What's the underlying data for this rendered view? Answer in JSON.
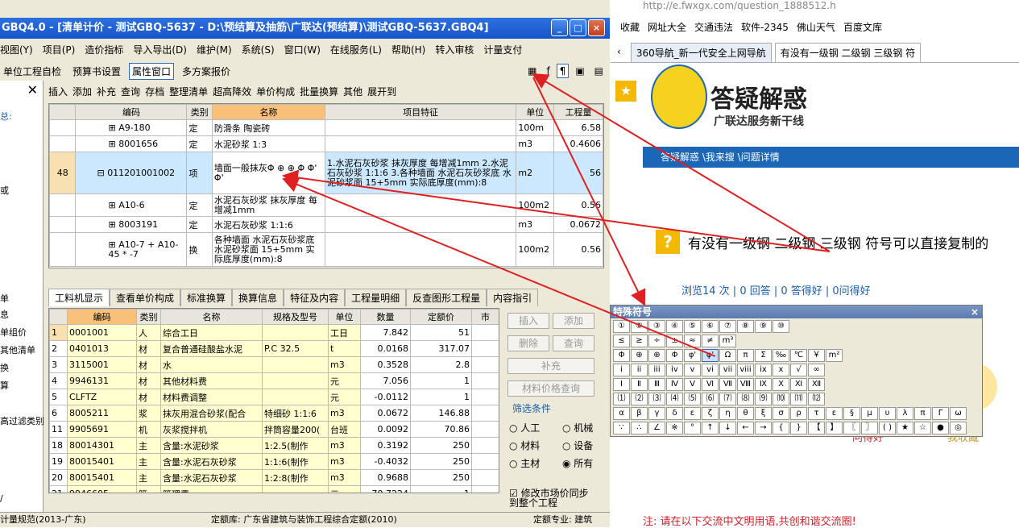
{
  "app": {
    "title": "GBQ4.0 - [清单计价 - 测试GBQ-5637 - D:\\预结算及抽筋\\广联达(预结算)\\测试GBQ-5637.GBQ4]",
    "window_buttons": [
      "_",
      "□",
      "×"
    ],
    "menu": [
      "视图(Y)",
      "项目(P)",
      "造价指标",
      "导入导出(D)",
      "维护(M)",
      "系统(S)",
      "窗口(W)",
      "在线服务(L)",
      "帮助(H)",
      "转入审核",
      "计量支付"
    ],
    "toolbar1": [
      "单位工程自检",
      "预算书设置",
      "属性窗口",
      "多方案报价"
    ],
    "toolbar2": [
      "插入",
      "添加",
      "补充",
      "查询",
      "存档",
      "整理清单",
      "超高降效",
      "单价构成",
      "批量换算",
      "其他",
      "展开到"
    ],
    "left_items": [
      "总:",
      "或",
      "单",
      "息",
      "单组价",
      "其他清单",
      "换",
      "算",
      "高过滤类别",
      "/"
    ],
    "top_headers": [
      "编码",
      "类别",
      "名称",
      "项目特征",
      "单位",
      "工程量"
    ],
    "top_rows": [
      {
        "no": "",
        "code": "A9-180",
        "type": "定",
        "name": "防滑条 陶瓷砖",
        "feature": "",
        "unit": "100m",
        "qty": "6.58"
      },
      {
        "no": "",
        "code": "8001656",
        "type": "定",
        "name": "水泥砂浆 1:3",
        "feature": "",
        "unit": "m3",
        "qty": "0.4606"
      },
      {
        "no": "48",
        "code": "011201001002",
        "type": "项",
        "name": "墙面一般抹灰Φ ⊕ ⊕ Φ Φ' Φ'",
        "feature": "1.水泥石灰砂浆 抹灰厚度 每增减1mm 2.水泥石灰砂浆 1:1:6 3.各种墙面 水泥石灰砂浆底 水泥砂浆面 15+5mm 实际底厚度(mm):8",
        "unit": "m2",
        "qty": "56"
      },
      {
        "no": "",
        "code": "A10-6",
        "type": "定",
        "name": "水泥石灰砂浆 抹灰厚度 每增减1mm",
        "feature": "",
        "unit": "100m2",
        "qty": "0.56"
      },
      {
        "no": "",
        "code": "8003191",
        "type": "定",
        "name": "水泥石灰砂浆 1:1:6",
        "feature": "",
        "unit": "m3",
        "qty": "0.0672"
      },
      {
        "no": "",
        "code": "A10-7 + A10-45 * -7",
        "type": "换",
        "name": "各种墙面 水泥石灰砂浆底 水泥砂浆面 15+5mm 实际底厚度(mm):8",
        "feature": "",
        "unit": "100m2",
        "qty": "0.56"
      }
    ],
    "tabs": [
      "工料机显示",
      "查看单价构成",
      "标准换算",
      "换算信息",
      "特征及内容",
      "工程量明细",
      "反查图形工程量",
      "内容指引"
    ],
    "bot_headers": [
      "编码",
      "类别",
      "名称",
      "规格及型号",
      "单位",
      "数量",
      "定额价",
      "市"
    ],
    "bot_rows": [
      {
        "no": "1",
        "code": "0001001",
        "type": "人",
        "name": "综合工日",
        "spec": "",
        "unit": "工日",
        "qty": "7.842",
        "price": "51"
      },
      {
        "no": "2",
        "code": "0401013",
        "type": "材",
        "name": "复合普通硅酸盐水泥",
        "spec": "P.C 32.5",
        "unit": "t",
        "qty": "0.0168",
        "price": "317.07"
      },
      {
        "no": "3",
        "code": "3115001",
        "type": "材",
        "name": "水",
        "spec": "",
        "unit": "m3",
        "qty": "0.3528",
        "price": "2.8"
      },
      {
        "no": "4",
        "code": "9946131",
        "type": "材",
        "name": "其他材料费",
        "spec": "",
        "unit": "元",
        "qty": "7.056",
        "price": "1"
      },
      {
        "no": "5",
        "code": "CLFTZ",
        "type": "材",
        "name": "材料费调整",
        "spec": "",
        "unit": "元",
        "qty": "-0.0112",
        "price": "1"
      },
      {
        "no": "6",
        "code": "8005211",
        "type": "浆",
        "name": "抹灰用混合砂浆(配合",
        "spec": "特细砂 1:1:6",
        "unit": "m3",
        "qty": "0.0672",
        "price": "146.88"
      },
      {
        "no": "11",
        "code": "9905691",
        "type": "机",
        "name": "灰浆搅拌机",
        "spec": "拌筒容量200(",
        "unit": "台班",
        "qty": "0.0092",
        "price": "70.86"
      },
      {
        "no": "18",
        "code": "80014301",
        "type": "主",
        "name": "含量:水泥砂浆",
        "spec": "1:2.5(制作",
        "unit": "m3",
        "qty": "0.3192",
        "price": "250"
      },
      {
        "no": "19",
        "code": "80015401",
        "type": "主",
        "name": "含量:水泥石灰砂浆",
        "spec": "1:1:6(制作",
        "unit": "m3",
        "qty": "-0.4032",
        "price": "250"
      },
      {
        "no": "20",
        "code": "80015401",
        "type": "主",
        "name": "含量:水泥石灰砂浆",
        "spec": "1:2:8(制作",
        "unit": "m3",
        "qty": "0.9688",
        "price": "250"
      },
      {
        "no": "21",
        "code": "9946605",
        "type": "管",
        "name": "管理费",
        "spec": "",
        "unit": "元",
        "qty": "70.7224",
        "price": "1"
      }
    ],
    "side_buttons": [
      "插入",
      "添加",
      "删除",
      "查询",
      "补充",
      "材料价格查询"
    ],
    "filter_label": "筛选条件",
    "radios": [
      "人工",
      "机械",
      "材料",
      "设备",
      "主材",
      "所有"
    ],
    "sync_label": "修改市场价同步到整个工程",
    "status": [
      "计量规范(2013-广东)",
      "定额库: 广东省建筑与装饰工程综合定额(2010)",
      "定额专业: 建筑"
    ]
  },
  "charpanel": {
    "title": "特殊符号",
    "close": "×",
    "rows": [
      [
        "①",
        "②",
        "③",
        "④",
        "⑤",
        "⑥",
        "⑦",
        "⑧",
        "⑨",
        "⑩"
      ],
      [
        "≤",
        "≥",
        "÷",
        "±",
        "≈",
        "≠",
        "m³"
      ],
      [
        "Φ",
        "⊕",
        "⊕",
        "Φ",
        "φ'",
        "φ'",
        "Ω",
        "π",
        "Σ",
        "‰",
        "℃",
        "￥",
        "m²"
      ],
      [
        "i",
        "ii",
        "iii",
        "iv",
        "v",
        "vi",
        "vii",
        "viii",
        "ix",
        "x",
        "√",
        "∞"
      ],
      [
        "Ⅰ",
        "Ⅱ",
        "Ⅲ",
        "Ⅳ",
        "Ⅴ",
        "Ⅵ",
        "Ⅶ",
        "Ⅷ",
        "Ⅸ",
        "Ⅹ",
        "Ⅺ",
        "Ⅻ"
      ],
      [
        "⑴",
        "⑵",
        "⑶",
        "⑷",
        "⑸",
        "⑹",
        "⑺",
        "⑻",
        "⑼",
        "⑽",
        "⑾",
        "⑿"
      ],
      [
        "α",
        "β",
        "γ",
        "δ",
        "ε",
        "ζ",
        "η",
        "θ",
        "ξ",
        "σ",
        "ρ",
        "τ",
        "ε",
        "§",
        "μ",
        "υ",
        "λ",
        "π",
        "Γ",
        "ω"
      ],
      [
        "∵",
        "∴",
        "∠",
        "※",
        "°",
        "↑",
        "↓",
        "←",
        "→",
        "{",
        "}",
        "【",
        "】",
        "〖",
        "〗",
        "( )",
        "★",
        "☆",
        "●",
        "◎"
      ]
    ]
  },
  "browser": {
    "url": "http://e.fwxgx.com/question_1888512.h",
    "bookmarks": [
      "收藏",
      "网址大全",
      "交通违法",
      "软件-2345",
      "佛山天气",
      "百度文库"
    ],
    "tabs": [
      "360导航_新一代安全上网导航",
      "有没有一级钢 二级钢 三级钢 符"
    ],
    "banner_title": "答疑解惑",
    "banner_sub": "广联达服务新干线",
    "breadcrumb": "答疑解惑 \\我来搜 \\问题详情",
    "question_badge": "?",
    "question": "有没有一级钢 二级钢 三级钢 符号可以直接复制的",
    "stats": "浏览14 次 | 0 回答 | 0 答得好 | 0问得好",
    "peek_left": "问得好",
    "peek_right": "我收藏",
    "note": "注: 请在以下交流中文明用语,共创和谐交流圈!"
  },
  "colors": {
    "titlebar": "#1555c9",
    "selected": "#cce8ff",
    "header_orange": "#f9c07a",
    "arrow": "#e02020"
  }
}
